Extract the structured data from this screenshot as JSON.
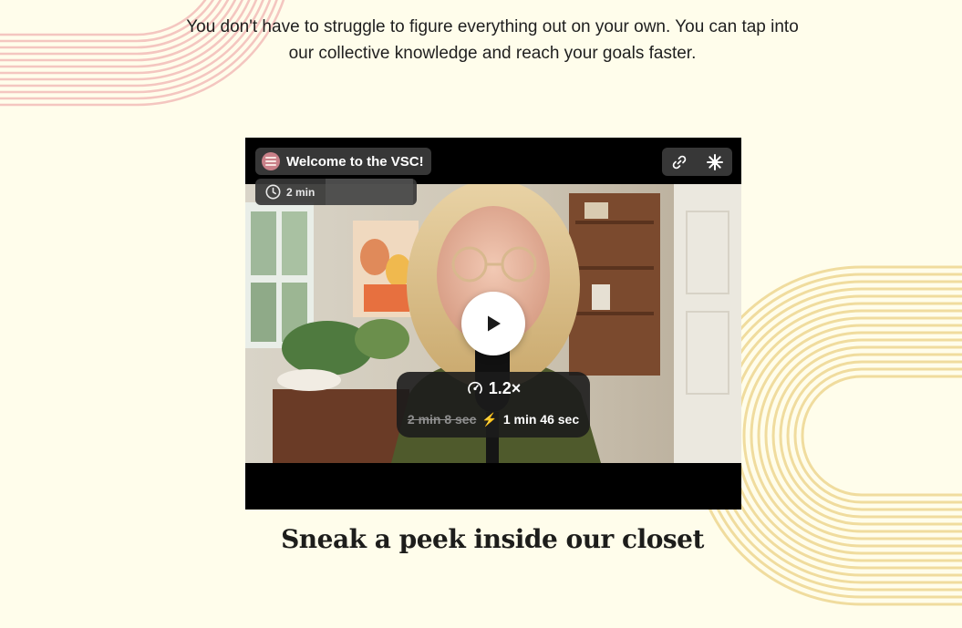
{
  "colors": {
    "background": "#fffdeb",
    "deco_pink": "#f4c6c0",
    "deco_gold": "#f0dc9e",
    "text": "#1c1c1c"
  },
  "intro": {
    "text": "You don't have to struggle to figure everything out on your own. You can tap into our collective knowledge and reach your goals faster."
  },
  "video": {
    "title": "Welcome to the VSC!",
    "duration": "2 min",
    "speed": "1.2×",
    "original_time": "2 min 8 sec",
    "bolt": "⚡",
    "new_time": "1 min 46 sec",
    "icons": [
      "clock-icon",
      "link-icon",
      "sparkle-icon",
      "play-icon",
      "speed-icon"
    ]
  },
  "section": {
    "heading": "Sneak a peek inside our closet"
  }
}
